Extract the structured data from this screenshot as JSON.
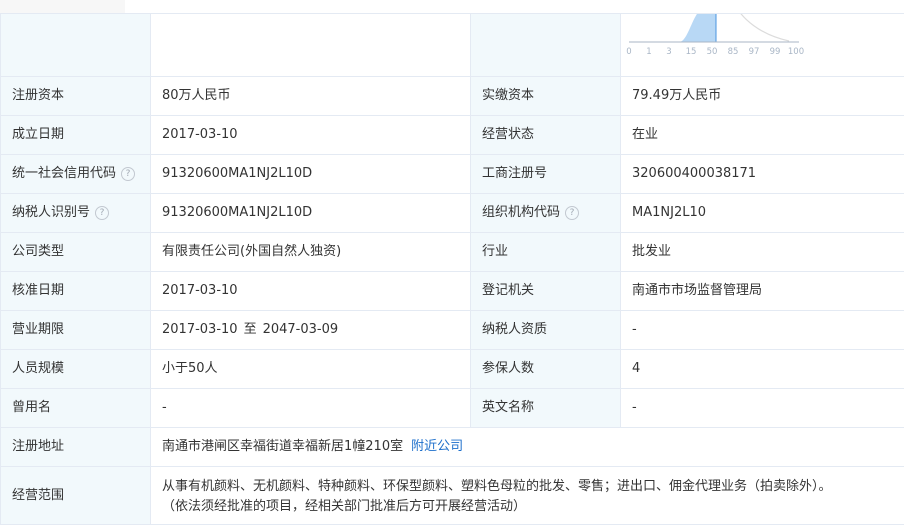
{
  "chart": {
    "ticks": [
      "0",
      "1",
      "3",
      "15",
      "50",
      "85",
      "97",
      "99",
      "100"
    ],
    "colors": {
      "fill": "#b8d8f5",
      "line": "#4a94e0",
      "gray": "#dcdcdc",
      "tick": "#a9b6c6"
    }
  },
  "rows": [
    {
      "l1": "注册资本",
      "v1": "80万人民币",
      "l2": "实缴资本",
      "v2": "79.49万人民币"
    },
    {
      "l1": "成立日期",
      "v1": "2017-03-10",
      "l2": "经营状态",
      "v2": "在业"
    },
    {
      "l1": "统一社会信用代码",
      "v1": "91320600MA1NJ2L10D",
      "l2": "工商注册号",
      "v2": "320600400038171"
    },
    {
      "l1": "纳税人识别号",
      "v1": "91320600MA1NJ2L10D",
      "l2": "组织机构代码",
      "v2": "MA1NJ2L10"
    },
    {
      "l1": "公司类型",
      "v1": "有限责任公司(外国自然人独资)",
      "l2": "行业",
      "v2": "批发业"
    },
    {
      "l1": "核准日期",
      "v1": "2017-03-10",
      "l2": "登记机关",
      "v2": "南通市市场监督管理局"
    },
    {
      "l1": "营业期限",
      "v1_from": "2017-03-10",
      "v1_sep": "至",
      "v1_to": "2047-03-09",
      "l2": "纳税人资质",
      "v2": "-"
    },
    {
      "l1": "人员规模",
      "v1": "小于50人",
      "l2": "参保人数",
      "v2": "4"
    },
    {
      "l1": "曾用名",
      "v1": "-",
      "l2": "英文名称",
      "v2": "-"
    }
  ],
  "address": {
    "label": "注册地址",
    "value": "南通市港闸区幸福街道幸福新居1幢210室",
    "link": "附近公司"
  },
  "scope": {
    "label": "经营范围",
    "line1": "从事有机颜料、无机颜料、特种颜料、环保型颜料、塑料色母粒的批发、零售；进出口、佣金代理业务（拍卖除外）。",
    "line2": "（依法须经批准的项目，经相关部门批准后方可开展经营活动）"
  },
  "help_glyph": "?"
}
